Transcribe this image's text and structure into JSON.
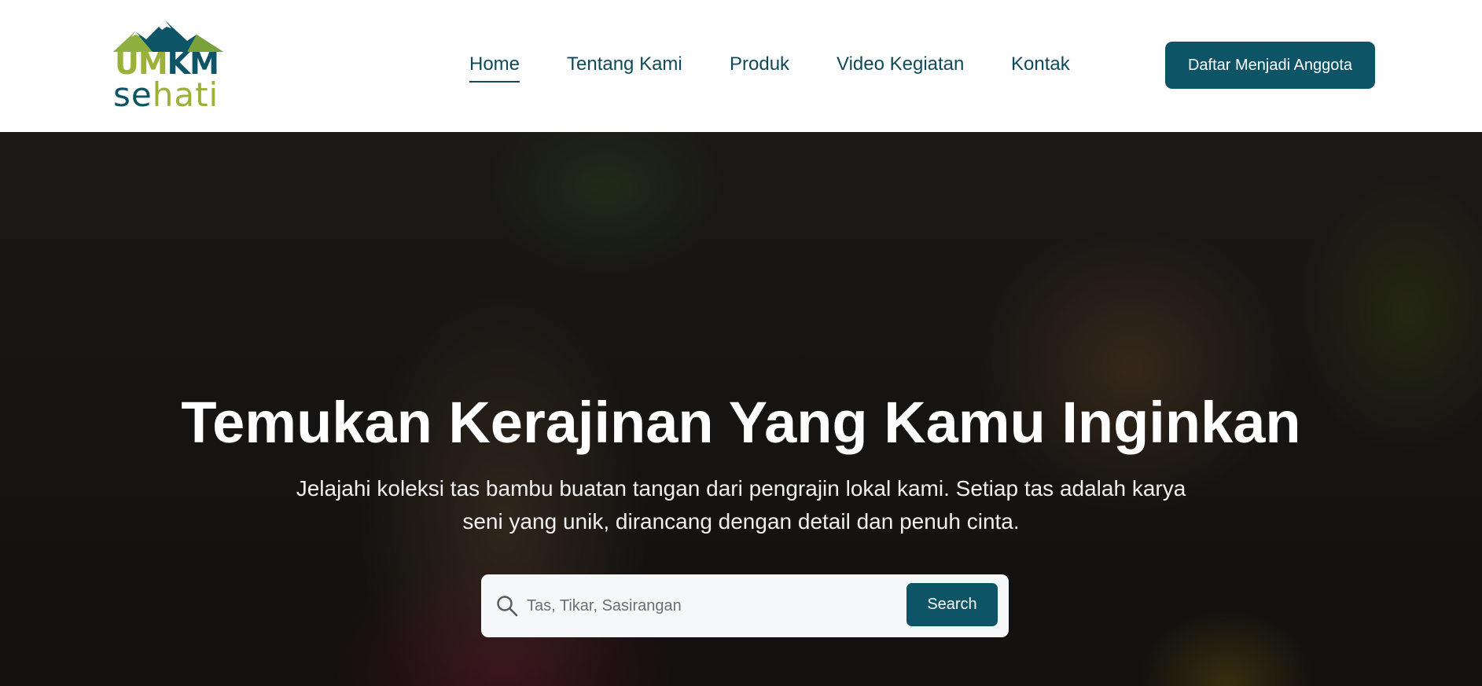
{
  "logo": {
    "line1_part1": "UM",
    "line1_part2": "KM",
    "line2_part1": "se",
    "line2_part2": "hati"
  },
  "nav": {
    "items": [
      {
        "label": "Home",
        "active": true
      },
      {
        "label": "Tentang Kami",
        "active": false
      },
      {
        "label": "Produk",
        "active": false
      },
      {
        "label": "Video Kegiatan",
        "active": false
      },
      {
        "label": "Kontak",
        "active": false
      }
    ]
  },
  "cta": {
    "label": "Daftar Menjadi Anggota"
  },
  "hero": {
    "title": "Temukan Kerajinan Yang Kamu Inginkan",
    "subtitle_line1": "Jelajahi koleksi tas bambu buatan tangan dari pengrajin lokal kami. Setiap tas adalah karya",
    "subtitle_line2": "seni yang unik, dirancang dengan detail dan penuh cinta."
  },
  "search": {
    "placeholder": "Tas, Tikar, Sasirangan",
    "value": "",
    "button_label": "Search"
  },
  "colors": {
    "brand_teal": "#0d5467",
    "brand_green": "#9bb23a"
  }
}
